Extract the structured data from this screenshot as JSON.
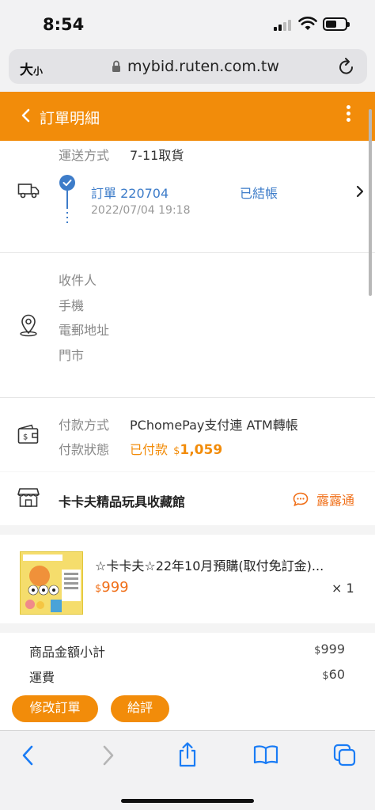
{
  "status_bar": {
    "time": "8:54"
  },
  "browser": {
    "font_size_label": "大",
    "font_size_small": "小",
    "url": "mybid.ruten.com.tw"
  },
  "header": {
    "title": "訂單明細"
  },
  "shipping": {
    "method_label": "運送方式",
    "method_value": "7-11取貨"
  },
  "order": {
    "number": "訂單 220704",
    "status": "已結帳",
    "datetime": "2022/07/04 19:18"
  },
  "recipient": {
    "name_label": "收件人",
    "phone_label": "手機",
    "email_label": "電郵地址",
    "store_label": "門市"
  },
  "payment": {
    "method_label": "付款方式",
    "method_value": "PChomePay支付連 ATM轉帳",
    "status_label": "付款狀態",
    "status_value": "已付款",
    "currency": "$",
    "amount": "1,059"
  },
  "store": {
    "name": "卡卡夫精品玩具收藏館",
    "chat_label": "露露通"
  },
  "product": {
    "title": "☆卡卡夫☆22年10月預購(取付免訂金)...",
    "currency": "$",
    "price": "999",
    "quantity": "× 1"
  },
  "summary": {
    "subtotal_label": "商品金額小計",
    "subtotal_currency": "$",
    "subtotal_value": "999",
    "shipping_label": "運費",
    "shipping_currency": "$",
    "shipping_value": "60"
  },
  "actions": {
    "edit_order": "修改訂單",
    "rate": "給評"
  },
  "colors": {
    "brand_orange": "#f28c0a",
    "link_blue": "#3d7cc9",
    "price_orange": "#f0701a"
  }
}
